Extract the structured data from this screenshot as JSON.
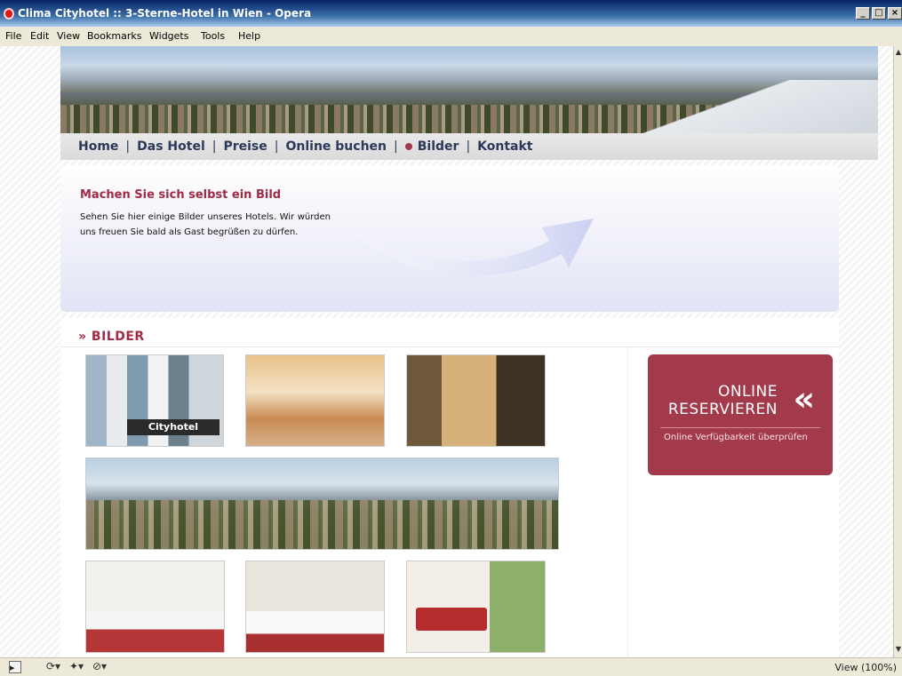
{
  "window": {
    "title": "Clima Cityhotel :: 3-Sterne-Hotel in Wien - Opera",
    "controls": [
      "_",
      "□",
      "×"
    ]
  },
  "menu": [
    "File",
    "Edit",
    "View",
    "Bookmarks",
    "Widgets",
    "Tools",
    "Help"
  ],
  "nav": {
    "home": "Home",
    "hotel": "Das Hotel",
    "preise": "Preise",
    "buchen": "Online buchen",
    "bilder": "Bilder",
    "kontakt": "Kontakt",
    "separator": "|"
  },
  "welcome": {
    "heading": "Machen Sie sich selbst ein Bild",
    "text": "Sehen Sie hier einige Bilder unseres Hotels. Wir würden uns freuen Sie bald als Gast begrüßen zu dürfen."
  },
  "section": {
    "heading": "» BILDER"
  },
  "photos": {
    "sign_text": "Cityhotel"
  },
  "reserve": {
    "line1": "ONLINE",
    "line2": "RESERVIEREN",
    "chevron": "«",
    "subtext": "Online Verfügbarkeit überprüfen"
  },
  "scroll": {
    "up": "▲",
    "down": "▼"
  },
  "status": {
    "zoom": "View (100%)",
    "panel_icon": "▸",
    "sync_icon": "⟳▾",
    "signal_icon": "✦▾",
    "block_icon": "⊘▾"
  },
  "colors": {
    "accent": "#a23a4c",
    "nav_text": "#2b3a5a"
  }
}
